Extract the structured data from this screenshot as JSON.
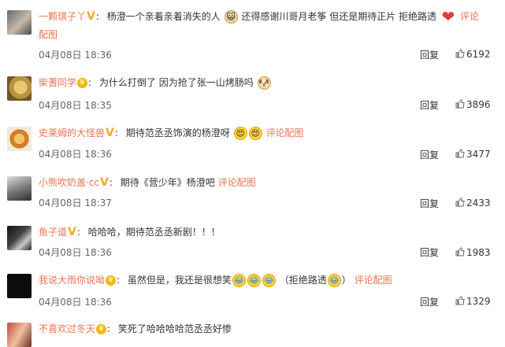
{
  "comments": [
    {
      "user": "一颗琪子丫",
      "badge": "V",
      "text_a": "杨澄一个亲着亲着消失的人",
      "text_b": "还得感谢川哥月老筝 但还是期待正片 拒绝路透",
      "link": "评论配图",
      "time": "04月08日 18:36",
      "reply": "回复",
      "likes": "6192"
    },
    {
      "user": "柴蓍同学",
      "badge": "crown",
      "text_a": "为什么打倒了 因为抢了张一山烤肠吗",
      "time": "04月08日 18:35",
      "reply": "回复",
      "likes": "3896"
    },
    {
      "user": "史莱姆的大怪兽",
      "badge": "V",
      "text_a": "期待范丞丞饰演的杨澄呀",
      "link": "评论配图",
      "time": "04月08日 18:36",
      "reply": "回复",
      "likes": "3477"
    },
    {
      "user": "小熊吹奶盖·cc",
      "badge": "V",
      "text_a": "期待《营少年》杨澄吧",
      "link": "评论配图",
      "time": "04月08日 18:37",
      "reply": "回复",
      "likes": "2433"
    },
    {
      "user": "鱼子道",
      "badge": "V",
      "text_a": "哈哈哈，期待范丞丞新剧！！！",
      "time": "04月08日 18:36",
      "reply": "回复",
      "likes": "1983"
    },
    {
      "user": "我说大雨你说呦",
      "badge": "crown",
      "text_a": "虽然但是，我还是很想笑",
      "text_b": "（拒绝路透",
      "text_c": "）",
      "link": "评论配图",
      "time": "04月08日 18:36",
      "reply": "回复",
      "likes": "1329"
    },
    {
      "user": "不喜欢过冬天",
      "badge": "crown",
      "text_a": "笑死了哈哈哈哈范丞丞好惨"
    }
  ],
  "icons": {
    "v_badge": "verified-v-icon",
    "crown": "vip-crown-icon",
    "thumb": "thumbs-up-icon",
    "heart": "heart-emoji-icon"
  },
  "colors": {
    "username": "#eb7350",
    "badge": "#f6a821",
    "text": "#333333"
  }
}
